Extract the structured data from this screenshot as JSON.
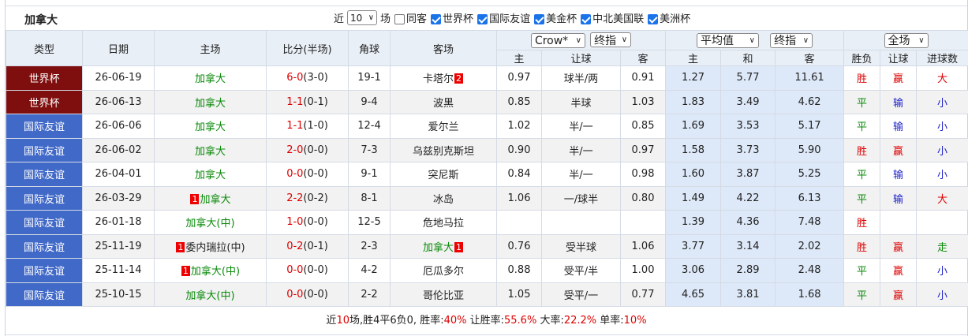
{
  "team": "加拿大",
  "filters": {
    "prefix": "近",
    "count": "10",
    "suffix": "场",
    "options": [
      {
        "label": "同客",
        "checked": false
      },
      {
        "label": "世界杯",
        "checked": true
      },
      {
        "label": "国际友谊",
        "checked": true
      },
      {
        "label": "美金杯",
        "checked": true
      },
      {
        "label": "中北美国联",
        "checked": true
      },
      {
        "label": "美洲杯",
        "checked": true
      }
    ]
  },
  "headers": {
    "type": "类型",
    "date": "日期",
    "home": "主场",
    "score": "比分(半场)",
    "corner": "角球",
    "away": "客场",
    "company_select": "Crow*",
    "asian_select": "终指",
    "avg_select": "平均值",
    "eu_select": "终指",
    "range_select": "全场",
    "sub_home": "主",
    "sub_handicap": "让球",
    "sub_away": "客",
    "sub_eu_home": "主",
    "sub_draw": "和",
    "sub_eu_away": "客",
    "sub_result": "胜负",
    "sub_hresult": "让球",
    "sub_goals": "进球数"
  },
  "rows": [
    {
      "type": "世界杯",
      "kind": "wc",
      "date": "26-06-19",
      "home": "加拿大",
      "home_card": "",
      "home_card_pos": "",
      "home_color": "green",
      "score": "6-0",
      "half": "(3-0)",
      "score_color": "red",
      "corner": "19-1",
      "away": "卡塔尔",
      "away_card": "2",
      "away_color": "",
      "o_home": "0.97",
      "o_hcp": "球半/两",
      "o_away": "0.91",
      "e_home": "1.27",
      "e_draw": "5.77",
      "e_away": "11.61",
      "res": "胜",
      "res_color": "red",
      "hres": "赢",
      "hres_color": "red",
      "goals": "大",
      "goals_color": "red"
    },
    {
      "type": "世界杯",
      "kind": "wc",
      "date": "26-06-13",
      "home": "加拿大",
      "home_card": "",
      "home_card_pos": "",
      "home_color": "green",
      "score": "1-1",
      "half": "(0-1)",
      "score_color": "red",
      "corner": "9-4",
      "away": "波黑",
      "away_card": "",
      "away_color": "",
      "o_home": "0.85",
      "o_hcp": "半球",
      "o_away": "1.03",
      "e_home": "1.83",
      "e_draw": "3.49",
      "e_away": "4.62",
      "res": "平",
      "res_color": "green",
      "hres": "输",
      "hres_color": "blue",
      "goals": "小",
      "goals_color": "blue"
    },
    {
      "type": "国际友谊",
      "kind": "fr",
      "date": "26-06-06",
      "home": "加拿大",
      "home_card": "",
      "home_card_pos": "",
      "home_color": "green",
      "score": "1-1",
      "half": "(1-0)",
      "score_color": "red",
      "corner": "12-4",
      "away": "爱尔兰",
      "away_card": "",
      "away_color": "",
      "o_home": "1.02",
      "o_hcp": "半/一",
      "o_away": "0.85",
      "e_home": "1.69",
      "e_draw": "3.53",
      "e_away": "5.17",
      "res": "平",
      "res_color": "green",
      "hres": "输",
      "hres_color": "blue",
      "goals": "小",
      "goals_color": "blue"
    },
    {
      "type": "国际友谊",
      "kind": "fr",
      "date": "26-06-02",
      "home": "加拿大",
      "home_card": "",
      "home_card_pos": "",
      "home_color": "green",
      "score": "2-0",
      "half": "(0-0)",
      "score_color": "red",
      "corner": "7-3",
      "away": "乌兹别克斯坦",
      "away_card": "",
      "away_color": "",
      "o_home": "0.90",
      "o_hcp": "半/一",
      "o_away": "0.97",
      "e_home": "1.58",
      "e_draw": "3.73",
      "e_away": "5.90",
      "res": "胜",
      "res_color": "red",
      "hres": "赢",
      "hres_color": "red",
      "goals": "小",
      "goals_color": "blue"
    },
    {
      "type": "国际友谊",
      "kind": "fr",
      "date": "26-04-01",
      "home": "加拿大",
      "home_card": "",
      "home_card_pos": "",
      "home_color": "green",
      "score": "0-0",
      "half": "(0-0)",
      "score_color": "red",
      "corner": "9-1",
      "away": "突尼斯",
      "away_card": "",
      "away_color": "",
      "o_home": "0.84",
      "o_hcp": "半/一",
      "o_away": "0.98",
      "e_home": "1.60",
      "e_draw": "3.87",
      "e_away": "5.25",
      "res": "平",
      "res_color": "green",
      "hres": "输",
      "hres_color": "blue",
      "goals": "小",
      "goals_color": "blue"
    },
    {
      "type": "国际友谊",
      "kind": "fr",
      "date": "26-03-29",
      "home": "加拿大",
      "home_card": "1",
      "home_card_pos": "before",
      "home_color": "green",
      "score": "2-2",
      "half": "(0-2)",
      "score_color": "red",
      "corner": "8-1",
      "away": "冰岛",
      "away_card": "",
      "away_color": "",
      "o_home": "1.06",
      "o_hcp": "一/球半",
      "o_away": "0.80",
      "e_home": "1.49",
      "e_draw": "4.22",
      "e_away": "6.13",
      "res": "平",
      "res_color": "green",
      "hres": "输",
      "hres_color": "blue",
      "goals": "大",
      "goals_color": "red"
    },
    {
      "type": "国际友谊",
      "kind": "fr",
      "date": "26-01-18",
      "home": "加拿大(中)",
      "home_card": "",
      "home_card_pos": "",
      "home_color": "green",
      "score": "1-0",
      "half": "(0-0)",
      "score_color": "red",
      "corner": "12-5",
      "away": "危地马拉",
      "away_card": "",
      "away_color": "",
      "o_home": "",
      "o_hcp": "",
      "o_away": "",
      "e_home": "1.39",
      "e_draw": "4.36",
      "e_away": "7.48",
      "res": "胜",
      "res_color": "red",
      "hres": "",
      "hres_color": "",
      "goals": "",
      "goals_color": ""
    },
    {
      "type": "国际友谊",
      "kind": "fr",
      "date": "25-11-19",
      "home": "委内瑞拉(中)",
      "home_card": "1",
      "home_card_pos": "before",
      "home_color": "",
      "score": "0-2",
      "half": "(0-1)",
      "score_color": "red",
      "corner": "2-3",
      "away": "加拿大",
      "away_card": "1",
      "away_color": "green",
      "o_home": "0.76",
      "o_hcp": "受半球",
      "o_away": "1.06",
      "e_home": "3.77",
      "e_draw": "3.14",
      "e_away": "2.02",
      "res": "胜",
      "res_color": "red",
      "hres": "赢",
      "hres_color": "red",
      "goals": "走",
      "goals_color": "green"
    },
    {
      "type": "国际友谊",
      "kind": "fr",
      "date": "25-11-14",
      "home": "加拿大(中)",
      "home_card": "1",
      "home_card_pos": "before",
      "home_color": "green",
      "score": "0-0",
      "half": "(0-0)",
      "score_color": "red",
      "corner": "4-2",
      "away": "厄瓜多尔",
      "away_card": "",
      "away_color": "",
      "o_home": "0.88",
      "o_hcp": "受平/半",
      "o_away": "1.00",
      "e_home": "3.06",
      "e_draw": "2.89",
      "e_away": "2.48",
      "res": "平",
      "res_color": "green",
      "hres": "赢",
      "hres_color": "red",
      "goals": "小",
      "goals_color": "blue"
    },
    {
      "type": "国际友谊",
      "kind": "fr",
      "date": "25-10-15",
      "home": "加拿大(中)",
      "home_card": "",
      "home_card_pos": "",
      "home_color": "green",
      "score": "0-0",
      "half": "(0-0)",
      "score_color": "red",
      "corner": "2-2",
      "away": "哥伦比亚",
      "away_card": "",
      "away_color": "",
      "o_home": "1.05",
      "o_hcp": "受平/一",
      "o_away": "0.77",
      "e_home": "4.65",
      "e_draw": "3.81",
      "e_away": "1.68",
      "res": "平",
      "res_color": "green",
      "hres": "赢",
      "hres_color": "red",
      "goals": "小",
      "goals_color": "blue"
    }
  ],
  "summary": {
    "prefix": "近",
    "n": "10",
    "mid": "场,胜4平6负0, 胜率:",
    "win_rate": "40%",
    "hcp_label": " 让胜率:",
    "hcp_rate": "55.6%",
    "big_label": " 大率:",
    "big_rate": "22.2%",
    "odd_label": " 单率:",
    "odd_rate": "10%"
  },
  "colors": {
    "wc": "#7f0f0f",
    "fr": "#4169c8",
    "win": "#dd0000",
    "draw": "#0a8a0a",
    "loss": "#1f22c9"
  }
}
